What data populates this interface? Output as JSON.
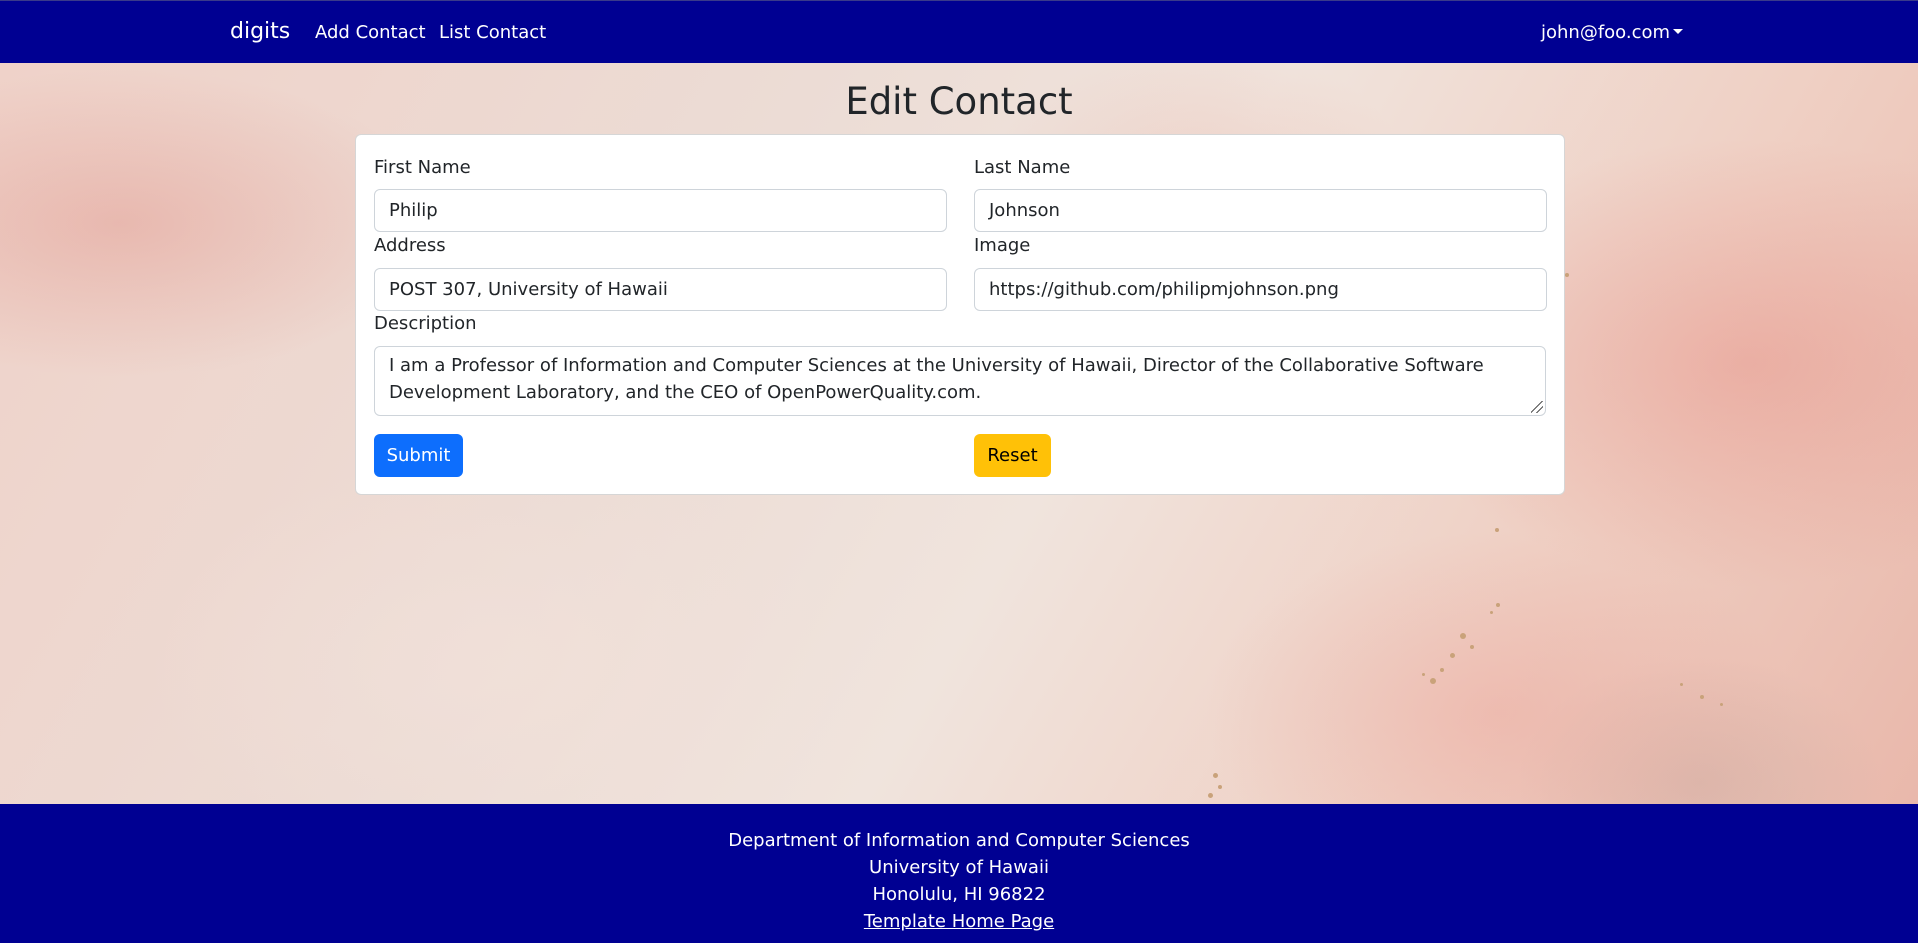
{
  "navbar": {
    "brand": "digits",
    "links": [
      "Add Contact",
      "List Contact"
    ],
    "user": "john@foo.com"
  },
  "page": {
    "title": "Edit Contact"
  },
  "form": {
    "first_name_label": "First Name",
    "first_name_value": "Philip",
    "last_name_label": "Last Name",
    "last_name_value": "Johnson",
    "address_label": "Address",
    "address_value": "POST 307, University of Hawaii",
    "image_label": "Image",
    "image_value": "https://github.com/philipmjohnson.png",
    "description_label": "Description",
    "description_value": "I am a Professor of Information and Computer Sciences at the University of Hawaii, Director of the Collaborative Software Development Laboratory, and the CEO of OpenPowerQuality.com.",
    "submit_label": "Submit",
    "reset_label": "Reset"
  },
  "footer": {
    "line1": "Department of Information and Computer Sciences",
    "line2": "University of Hawaii",
    "line3": "Honolulu, HI 96822",
    "link": "Template Home Page"
  },
  "colors": {
    "navbar": "#000092",
    "submit": "#0d6efd",
    "reset": "#ffc107"
  }
}
